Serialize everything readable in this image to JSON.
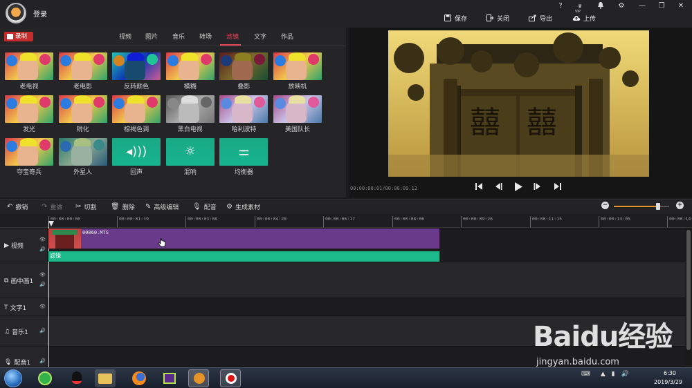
{
  "header": {
    "login_label": "登录",
    "help": "?",
    "vip": "VIP",
    "actions": [
      {
        "label": "保存",
        "icon": "save-icon"
      },
      {
        "label": "关闭",
        "icon": "close-project-icon"
      },
      {
        "label": "导出",
        "icon": "export-icon"
      },
      {
        "label": "上传",
        "icon": "upload-icon"
      }
    ]
  },
  "left_panel": {
    "record_label": "录制",
    "tabs": [
      {
        "label": "视频",
        "active": false
      },
      {
        "label": "图片",
        "active": false
      },
      {
        "label": "音乐",
        "active": false
      },
      {
        "label": "转场",
        "active": false
      },
      {
        "label": "滤镜",
        "active": true
      },
      {
        "label": "文字",
        "active": false
      },
      {
        "label": "作品",
        "active": false
      }
    ],
    "filters": [
      {
        "label": "老电视",
        "style": "photo"
      },
      {
        "label": "老电影",
        "style": "photo"
      },
      {
        "label": "反转颜色",
        "style": "invert"
      },
      {
        "label": "模糊",
        "style": "photo"
      },
      {
        "label": "叠影",
        "style": "dark"
      },
      {
        "label": "放映机",
        "style": "photo"
      },
      {
        "label": "发光",
        "style": "photo"
      },
      {
        "label": "锐化",
        "style": "photo"
      },
      {
        "label": "棕褐色调",
        "style": "photo"
      },
      {
        "label": "黑白电视",
        "style": "gray"
      },
      {
        "label": "哈利波特",
        "style": "cool"
      },
      {
        "label": "美国队长",
        "style": "cool"
      },
      {
        "label": "夺宝奇兵",
        "style": "photo"
      },
      {
        "label": "外星人",
        "style": "teal"
      },
      {
        "label": "回声",
        "style": "green",
        "icon": "echo-icon"
      },
      {
        "label": "混响",
        "style": "green",
        "icon": "reverb-icon"
      },
      {
        "label": "均衡器",
        "style": "green",
        "icon": "equalizer-icon"
      }
    ]
  },
  "preview": {
    "time": "00:00:00:01/00:00:09.12"
  },
  "toolbar": {
    "undo": "撤销",
    "redo": "重做",
    "cut": "切割",
    "delete": "删除",
    "advanced_edit": "高级编辑",
    "dubbing": "配音",
    "generate": "生成素材",
    "zoom_level": 0.8
  },
  "ruler": {
    "ticks": [
      "00:00:00:00",
      "00:00:01:19",
      "00:00:03:08",
      "00:00:04:28",
      "00:00:06:17",
      "00:00:08:06",
      "00:00:09:26",
      "00:00:11:15",
      "00:00:13:05",
      "00:00:14:"
    ]
  },
  "tracks": {
    "video": "视频",
    "pip": "画中画1",
    "text": "文字1",
    "music": "音乐1",
    "voice": "配音1",
    "clip_name": "00060.MTS",
    "filter_name": "滤镜"
  },
  "watermark": {
    "title": "Baidu经验",
    "url": "jingyan.baidu.com"
  },
  "taskbar": {
    "time": "6:30",
    "date": "2019/3/29"
  },
  "colors": {
    "accent": "#e8455a",
    "clip": "#6a3a8a",
    "filter_bar": "#1cba8a",
    "zoom_fill": "#e7932a"
  }
}
